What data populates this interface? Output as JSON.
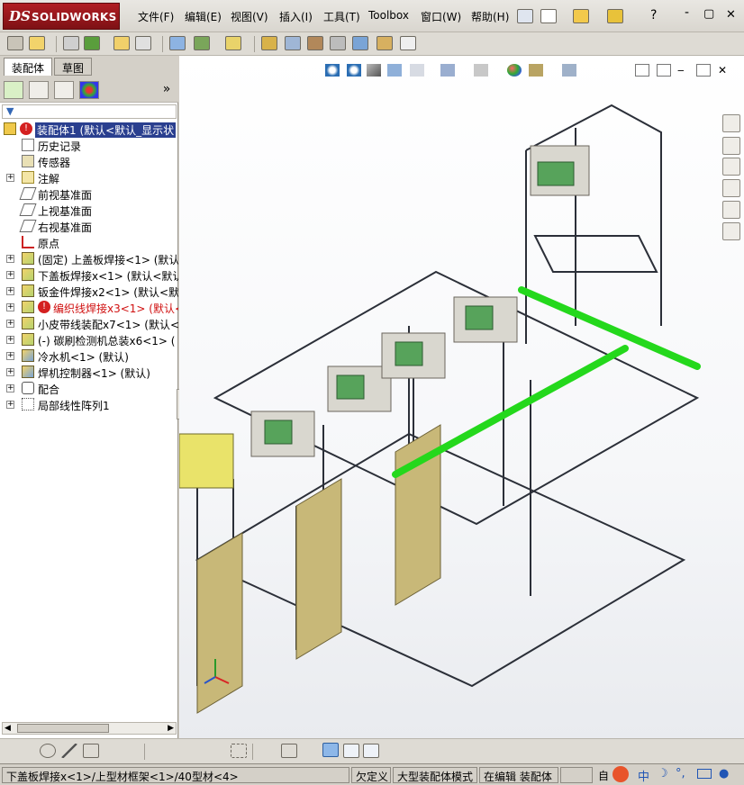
{
  "app": {
    "logo_ds": "DS",
    "logo_name": "SOLIDWORKS"
  },
  "menu": [
    "文件(F)",
    "编辑(E)",
    "视图(V)",
    "插入(I)",
    "工具(T)",
    "Toolbox",
    "窗口(W)",
    "帮助(H)"
  ],
  "help_btn": "?",
  "window_controls": {
    "minimize": "-",
    "restore": "▢",
    "close": "✕"
  },
  "tabs": [
    "装配体",
    "草图"
  ],
  "panel": {
    "expand": "»"
  },
  "tree": [
    {
      "label": "装配体1  (默认<默认_显示状",
      "icon": "assembly-icon",
      "exp": "-",
      "indent": 0,
      "selected": true,
      "error": true
    },
    {
      "label": "历史记录",
      "icon": "history-icon",
      "exp": "",
      "indent": 1
    },
    {
      "label": "传感器",
      "icon": "sensor-icon",
      "exp": "",
      "indent": 1
    },
    {
      "label": "注解",
      "icon": "annotation-icon",
      "exp": "+",
      "indent": 1
    },
    {
      "label": "前视基准面",
      "icon": "plane-icon",
      "exp": "",
      "indent": 1
    },
    {
      "label": "上视基准面",
      "icon": "plane-icon",
      "exp": "",
      "indent": 1
    },
    {
      "label": "右视基准面",
      "icon": "plane-icon",
      "exp": "",
      "indent": 1
    },
    {
      "label": "原点",
      "icon": "origin-icon",
      "exp": "",
      "indent": 1
    },
    {
      "label": "(固定) 上盖板焊接<1> (默认<",
      "icon": "part-icon",
      "exp": "+",
      "indent": 1
    },
    {
      "label": "下盖板焊接x<1> (默认<默认",
      "icon": "part-icon",
      "exp": "+",
      "indent": 1
    },
    {
      "label": "钣金件焊接x2<1> (默认<默认",
      "icon": "part-icon",
      "exp": "+",
      "indent": 1
    },
    {
      "label": "编织线焊接x3<1> (默认<9",
      "icon": "part-icon",
      "exp": "+",
      "indent": 1,
      "error": true,
      "red": true
    },
    {
      "label": "小皮带线装配x7<1> (默认<",
      "icon": "part-icon",
      "exp": "+",
      "indent": 1
    },
    {
      "label": "(-) 碳刷检测机总装x6<1> (",
      "icon": "part-icon",
      "exp": "+",
      "indent": 1
    },
    {
      "label": "冷水机<1> (默认)",
      "icon": "subassembly-icon",
      "exp": "+",
      "indent": 1
    },
    {
      "label": "焊机控制器<1> (默认)",
      "icon": "subassembly-icon",
      "exp": "+",
      "indent": 1
    },
    {
      "label": "配合",
      "icon": "mate-icon",
      "exp": "+",
      "indent": 1
    },
    {
      "label": "局部线性阵列1",
      "icon": "pattern-icon",
      "exp": "+",
      "indent": 1
    }
  ],
  "status": {
    "path": "下盖板焊接x<1>/上型材框架<1>/40型材<4>",
    "defined": "欠定义",
    "mode": "大型装配体模式",
    "editing": "在编辑 装配体",
    "auto": "自",
    "ime": "中"
  }
}
